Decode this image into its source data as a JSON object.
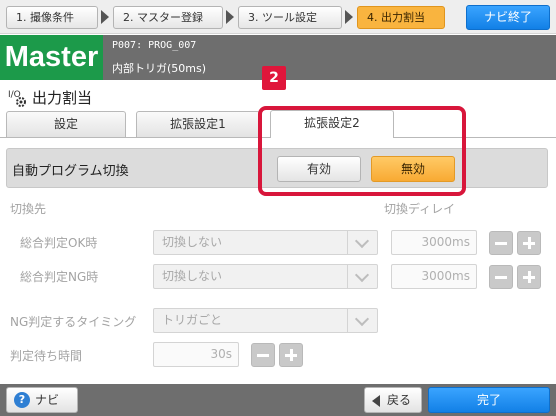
{
  "steps": [
    {
      "label": "1. 撮像条件"
    },
    {
      "label": "2. マスター登録"
    },
    {
      "label": "3. ツール設定"
    },
    {
      "label": "4. 出力割当"
    }
  ],
  "navi_end_label": "ナビ終了",
  "master": {
    "label": "Master",
    "program_line": "P007: PROG_007",
    "trigger_line": "内部トリガ(50ms)"
  },
  "page_title": "出力割当",
  "tabs": [
    {
      "label": "設定"
    },
    {
      "label": "拡張設定1"
    },
    {
      "label": "拡張設定2"
    }
  ],
  "annotation_badge": "2",
  "auto_switch": {
    "title": "自動プログラム切換",
    "enable_label": "有効",
    "disable_label": "無効",
    "selected": "無効"
  },
  "switch_dest_label": "切換先",
  "switch_delay_label": "切換ディレイ",
  "ok_row": {
    "label": "総合判定OK時",
    "select_value": "切換しない",
    "delay_value": "3000ms"
  },
  "ng_row": {
    "label": "総合判定NG時",
    "select_value": "切換しない",
    "delay_value": "3000ms"
  },
  "ng_timing": {
    "label": "NG判定するタイミング",
    "select_value": "トリガごと"
  },
  "wait_time": {
    "label": "判定待ち時間",
    "value": "30s"
  },
  "footer": {
    "help_glyph": "?",
    "navi_label": "ナビ",
    "back_label": "戻る",
    "done_label": "完了"
  },
  "colors": {
    "accent_orange": "#f9b43f",
    "master_green": "#1c9a4a",
    "button_blue": "#1a8cf0",
    "highlight_red": "#d8163b"
  }
}
